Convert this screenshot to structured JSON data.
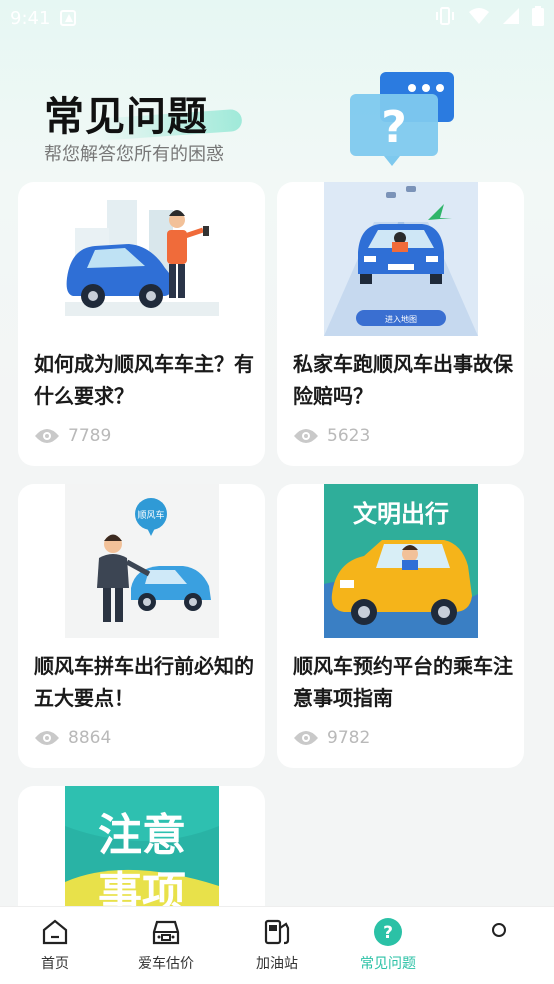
{
  "status_bar": {
    "time": "9:41"
  },
  "header": {
    "title": "常见问题",
    "subtitle": "帮您解答您所有的困惑"
  },
  "cards": [
    {
      "title": "如何成为顺风车车主？有什么要求？",
      "views": "7789"
    },
    {
      "title": "私家车跑顺风车出事故保险赔吗？",
      "views": "5623"
    },
    {
      "title": "顺风车拼车出行前必知的五大要点！",
      "views": "8864",
      "badge": "顺风车"
    },
    {
      "title": "顺风车预约平台的乘车注意事项指南",
      "views": "9782",
      "banner": "文明出行"
    },
    {
      "banner": "注意事项"
    }
  ],
  "thumb2_button": "进入地图",
  "bottom_nav": [
    {
      "label": "首页",
      "icon": "home-icon"
    },
    {
      "label": "爱车估价",
      "icon": "car-value-icon"
    },
    {
      "label": "加油站",
      "icon": "gas-station-icon"
    },
    {
      "label": "常见问题",
      "icon": "question-icon",
      "active": true
    },
    {
      "label": "",
      "icon": "profile-icon"
    }
  ],
  "colors": {
    "accent": "#2bc1a6",
    "text": "#1a1a1a",
    "muted": "#b9b9b9"
  }
}
